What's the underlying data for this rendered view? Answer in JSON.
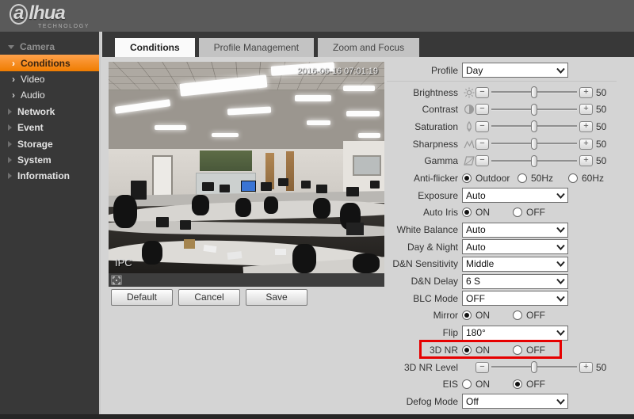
{
  "header": {
    "logo_a": "a",
    "logo_rest": "lhua",
    "logo_sub": "TECHNOLOGY"
  },
  "sidebar": {
    "camera": "Camera",
    "conditions": "Conditions",
    "video": "Video",
    "audio": "Audio",
    "network": "Network",
    "event": "Event",
    "storage": "Storage",
    "system": "System",
    "information": "Information"
  },
  "tabs": {
    "conditions": "Conditions",
    "profile_management": "Profile Management",
    "zoom_focus": "Zoom and Focus"
  },
  "video": {
    "timestamp": "2016-06-16 07:01:19",
    "label": "IPC"
  },
  "buttons": {
    "default": "Default",
    "cancel": "Cancel",
    "save": "Save"
  },
  "icons": {
    "minus": "−",
    "plus": "+",
    "chevron_right": "›"
  },
  "settings": {
    "profile": {
      "label": "Profile",
      "value": "Day"
    },
    "sliders": [
      {
        "label": "Brightness",
        "value": "50"
      },
      {
        "label": "Contrast",
        "value": "50"
      },
      {
        "label": "Saturation",
        "value": "50"
      },
      {
        "label": "Sharpness",
        "value": "50"
      },
      {
        "label": "Gamma",
        "value": "50"
      }
    ],
    "anti_flicker": {
      "label": "Anti-flicker",
      "options": [
        "Outdoor",
        "50Hz",
        "60Hz"
      ],
      "selected": "Outdoor"
    },
    "exposure": {
      "label": "Exposure",
      "value": "Auto"
    },
    "auto_iris": {
      "label": "Auto Iris",
      "on": "ON",
      "off": "OFF",
      "selected": "ON"
    },
    "white_balance": {
      "label": "White Balance",
      "value": "Auto"
    },
    "day_night": {
      "label": "Day & Night",
      "value": "Auto"
    },
    "dn_sensitivity": {
      "label": "D&N Sensitivity",
      "value": "Middle"
    },
    "dn_delay": {
      "label": "D&N Delay",
      "value": "6 S"
    },
    "blc_mode": {
      "label": "BLC Mode",
      "value": "OFF"
    },
    "mirror": {
      "label": "Mirror",
      "on": "ON",
      "off": "OFF",
      "selected": "ON"
    },
    "flip": {
      "label": "Flip",
      "value": "180°"
    },
    "nr_3d": {
      "label": "3D NR",
      "on": "ON",
      "off": "OFF",
      "selected": "ON",
      "highlighted": true
    },
    "nr_3d_level": {
      "label": "3D NR Level",
      "value": "50"
    },
    "eis": {
      "label": "EIS",
      "on": "ON",
      "off": "OFF",
      "selected": "OFF"
    },
    "defog": {
      "label": "Defog Mode",
      "value": "Off"
    }
  },
  "colors": {
    "accent_orange": "#ef7c00",
    "highlight_red": "#e60000",
    "header_bg": "#5a5a5a",
    "nav_bg": "#383838",
    "content_bg": "#d4d4d4"
  }
}
